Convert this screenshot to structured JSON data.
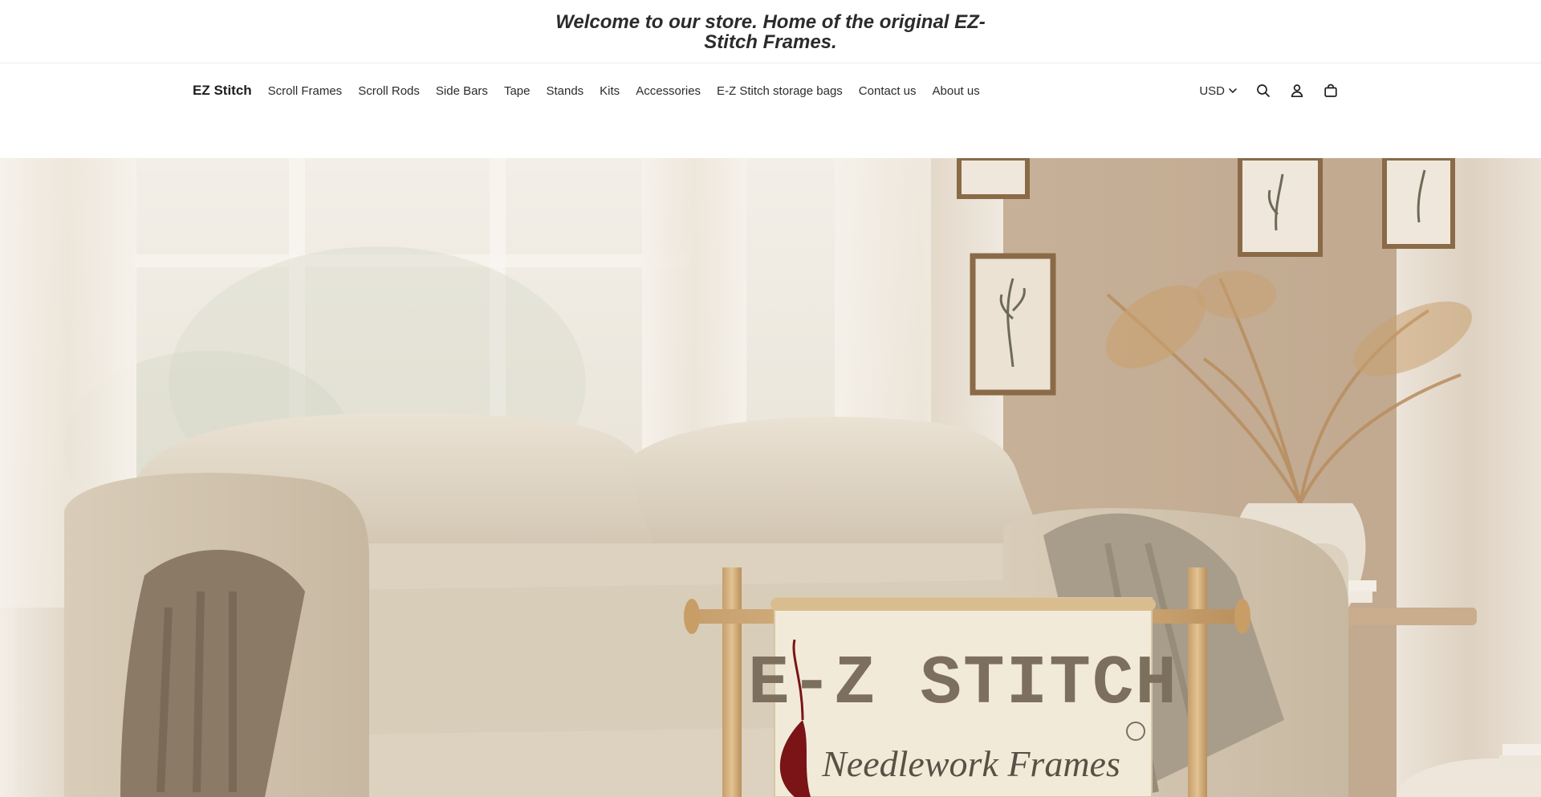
{
  "announcement": {
    "text": "Welcome to our store. Home of the original EZ-Stitch Frames."
  },
  "header": {
    "logo": "EZ Stitch",
    "nav": [
      {
        "label": "Scroll Frames"
      },
      {
        "label": "Scroll Rods"
      },
      {
        "label": "Side Bars"
      },
      {
        "label": "Tape"
      },
      {
        "label": "Stands"
      },
      {
        "label": "Kits"
      },
      {
        "label": "Accessories"
      },
      {
        "label": "E-Z Stitch storage bags"
      },
      {
        "label": "Contact us"
      },
      {
        "label": "About us"
      }
    ],
    "currency": "USD",
    "icons": [
      "chevron-down-icon",
      "search-icon",
      "account-icon",
      "cart-icon"
    ]
  },
  "hero": {
    "sign_title": "E-Z STITCH",
    "sign_subtitle": "Needlework Frames",
    "colors": {
      "wall": "#c7b39c",
      "window": "#f1ede4",
      "sofa": "#e2d8c8",
      "wood": "#d9b98c",
      "thread": "#7a1416"
    }
  }
}
